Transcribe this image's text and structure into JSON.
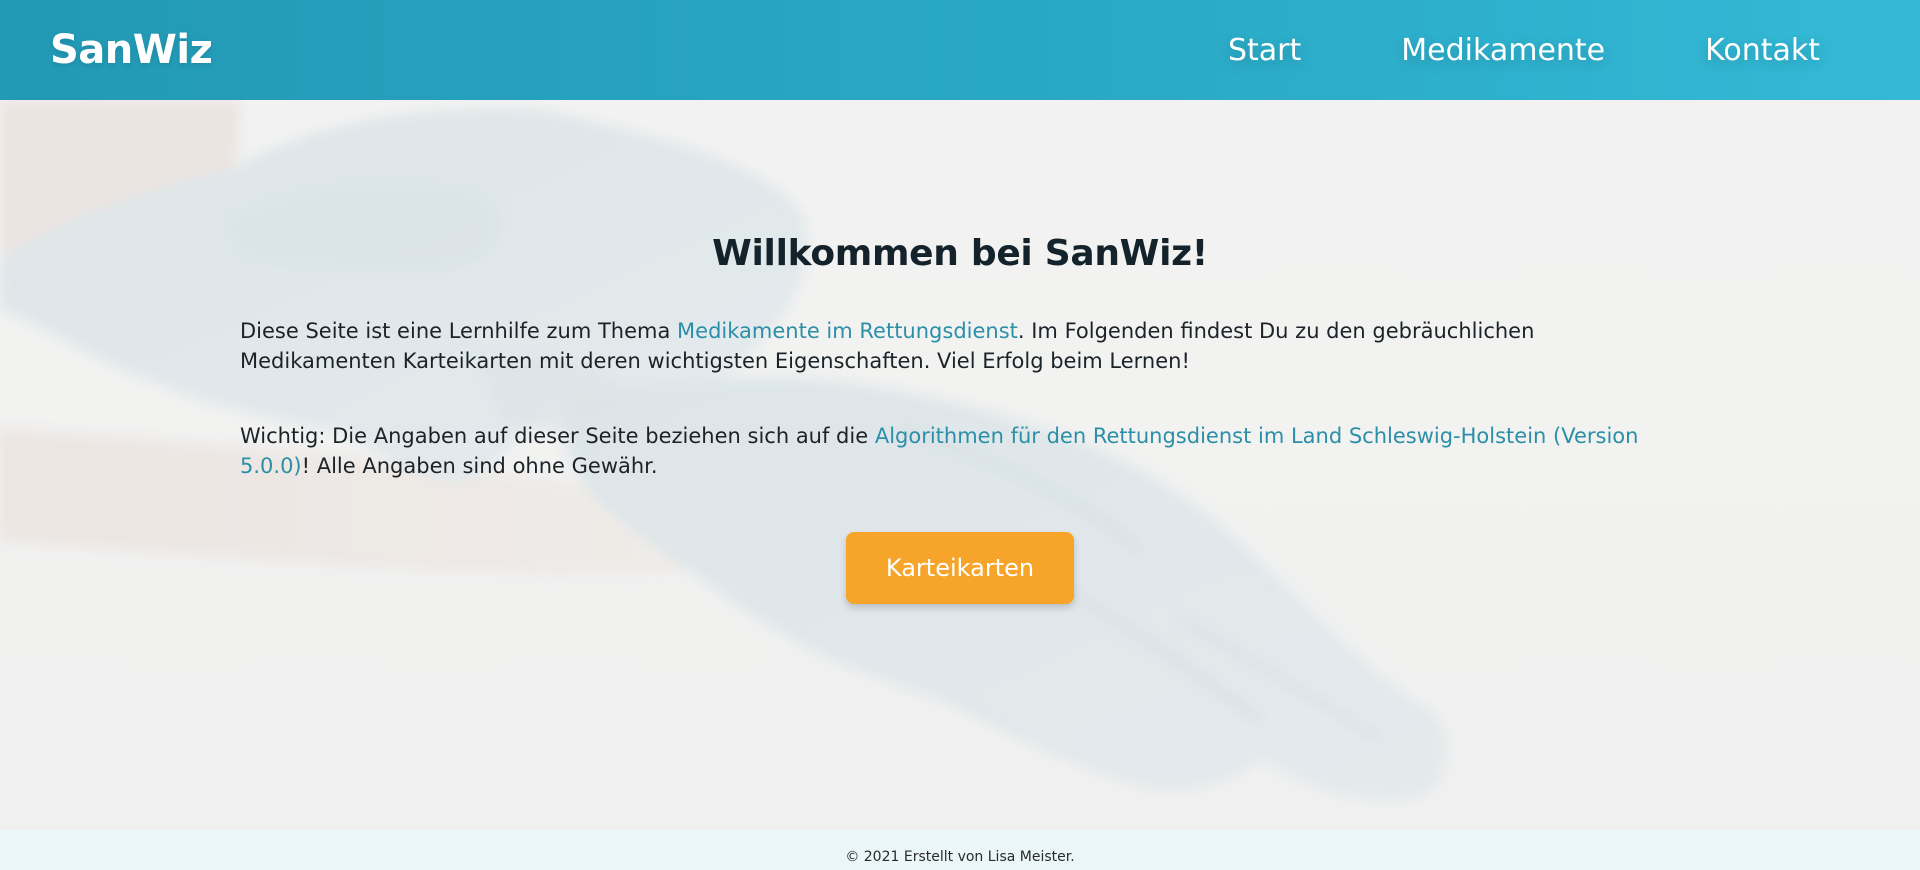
{
  "header": {
    "logo": "SanWiz",
    "nav": [
      {
        "label": "Start"
      },
      {
        "label": "Medikamente"
      },
      {
        "label": "Kontakt"
      }
    ]
  },
  "main": {
    "title": "Willkommen bei SanWiz!",
    "paragraph1": {
      "before": "Diese Seite ist eine Lernhilfe zum Thema ",
      "link": "Medikamente im Rettungsdienst",
      "after": ". Im Folgenden findest Du zu den gebräuchlichen Medikamenten Karteikarten mit deren wichtigsten Eigenschaften. Viel Erfolg beim Lernen!"
    },
    "paragraph2": {
      "before": "Wichtig: Die Angaben auf dieser Seite beziehen sich auf die ",
      "link": "Algorithmen für den Rettungsdienst im Land Schleswig-Holstein (Version 5.0.0)",
      "after": "! Alle Angaben sind ohne Gewähr."
    },
    "button_label": "Karteikarten"
  },
  "footer": {
    "text": "© 2021 Erstellt von Lisa Meister."
  },
  "colors": {
    "header": "#2aaac6",
    "accent_link": "#2b8fa8",
    "button": "#f7a52a",
    "footer_bg": "#eaf6f8"
  }
}
